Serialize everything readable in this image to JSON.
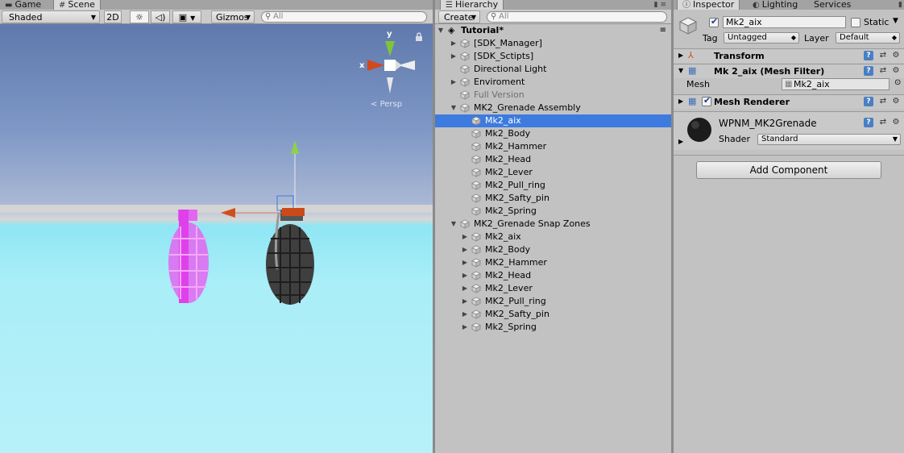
{
  "scene_panel": {
    "tabs": [
      {
        "label": "Game",
        "icon": "game-icon"
      },
      {
        "label": "Scene",
        "icon": "scene-icon"
      }
    ],
    "toolbar": {
      "shading_mode": "Shaded",
      "mode_2d": "2D",
      "gizmos": "Gizmos",
      "search_placeholder": "All"
    },
    "gizmo": {
      "y_label": "y",
      "x_label": "x",
      "view_label": "Persp"
    },
    "colors": {
      "sky_top": "#5f79ad",
      "ground": "#a9eef8",
      "ghost_grenade": "#e066ee",
      "arrow_orange": "#c8501e",
      "arrow_green": "#7dba3a"
    }
  },
  "hierarchy_panel": {
    "tab_label": "Hierarchy",
    "create_label": "Create",
    "search_placeholder": "All",
    "scene_name": "Tutorial*",
    "rows": [
      {
        "label": "[SDK_Manager]",
        "depth": 1,
        "foldout": "collapsed",
        "state": "normal"
      },
      {
        "label": "[SDK_Sctipts]",
        "depth": 1,
        "foldout": "collapsed",
        "state": "normal"
      },
      {
        "label": "Directional Light",
        "depth": 1,
        "foldout": "none",
        "state": "normal"
      },
      {
        "label": "Enviroment",
        "depth": 1,
        "foldout": "collapsed",
        "state": "normal"
      },
      {
        "label": "Full Version",
        "depth": 1,
        "foldout": "none",
        "state": "inactive"
      },
      {
        "label": "MK2_Grenade Assembly",
        "depth": 1,
        "foldout": "expanded",
        "state": "normal"
      },
      {
        "label": "Mk2_aix",
        "depth": 2,
        "foldout": "none",
        "state": "selected"
      },
      {
        "label": "Mk2_Body",
        "depth": 2,
        "foldout": "none",
        "state": "normal"
      },
      {
        "label": "Mk2_Hammer",
        "depth": 2,
        "foldout": "none",
        "state": "normal"
      },
      {
        "label": "Mk2_Head",
        "depth": 2,
        "foldout": "none",
        "state": "normal"
      },
      {
        "label": "Mk2_Lever",
        "depth": 2,
        "foldout": "none",
        "state": "normal"
      },
      {
        "label": "Mk2_Pull_ring",
        "depth": 2,
        "foldout": "none",
        "state": "normal"
      },
      {
        "label": "MK2_Safty_pin",
        "depth": 2,
        "foldout": "none",
        "state": "normal"
      },
      {
        "label": "Mk2_Spring",
        "depth": 2,
        "foldout": "none",
        "state": "normal"
      },
      {
        "label": "MK2_Grenade Snap Zones",
        "depth": 1,
        "foldout": "expanded",
        "state": "normal"
      },
      {
        "label": "Mk2_aix",
        "depth": 2,
        "foldout": "collapsed",
        "state": "normal"
      },
      {
        "label": "Mk2_Body",
        "depth": 2,
        "foldout": "collapsed",
        "state": "normal"
      },
      {
        "label": "MK2_Hammer",
        "depth": 2,
        "foldout": "collapsed",
        "state": "normal"
      },
      {
        "label": "Mk2_Head",
        "depth": 2,
        "foldout": "collapsed",
        "state": "normal"
      },
      {
        "label": "Mk2_Lever",
        "depth": 2,
        "foldout": "collapsed",
        "state": "normal"
      },
      {
        "label": "MK2_Pull_ring",
        "depth": 2,
        "foldout": "collapsed",
        "state": "normal"
      },
      {
        "label": "MK2_Safty_pin",
        "depth": 2,
        "foldout": "collapsed",
        "state": "normal"
      },
      {
        "label": "Mk2_Spring",
        "depth": 2,
        "foldout": "collapsed",
        "state": "normal"
      }
    ]
  },
  "inspector_panel": {
    "tabs": [
      {
        "label": "Inspector",
        "icon": "info-icon"
      },
      {
        "label": "Lighting",
        "icon": "lighting-icon"
      },
      {
        "label": "Services",
        "icon": ""
      }
    ],
    "object": {
      "active": true,
      "name": "Mk2_aix",
      "static_label": "Static",
      "static": false,
      "tag_label": "Tag",
      "tag_value": "Untagged",
      "layer_label": "Layer",
      "layer_value": "Default"
    },
    "components": {
      "transform": "Transform",
      "mesh_filter_title": "Mk 2_aix (Mesh Filter)",
      "mesh_label": "Mesh",
      "mesh_value": "Mk2_aix",
      "mesh_renderer": "Mesh Renderer",
      "mesh_renderer_enabled": true
    },
    "material": {
      "name": "WPNM_MK2Grenade",
      "shader_label": "Shader",
      "shader_value": "Standard"
    },
    "add_component_label": "Add Component",
    "colors": {
      "selection": "#3d7bde",
      "help_icon": "#4a7fc4"
    }
  }
}
